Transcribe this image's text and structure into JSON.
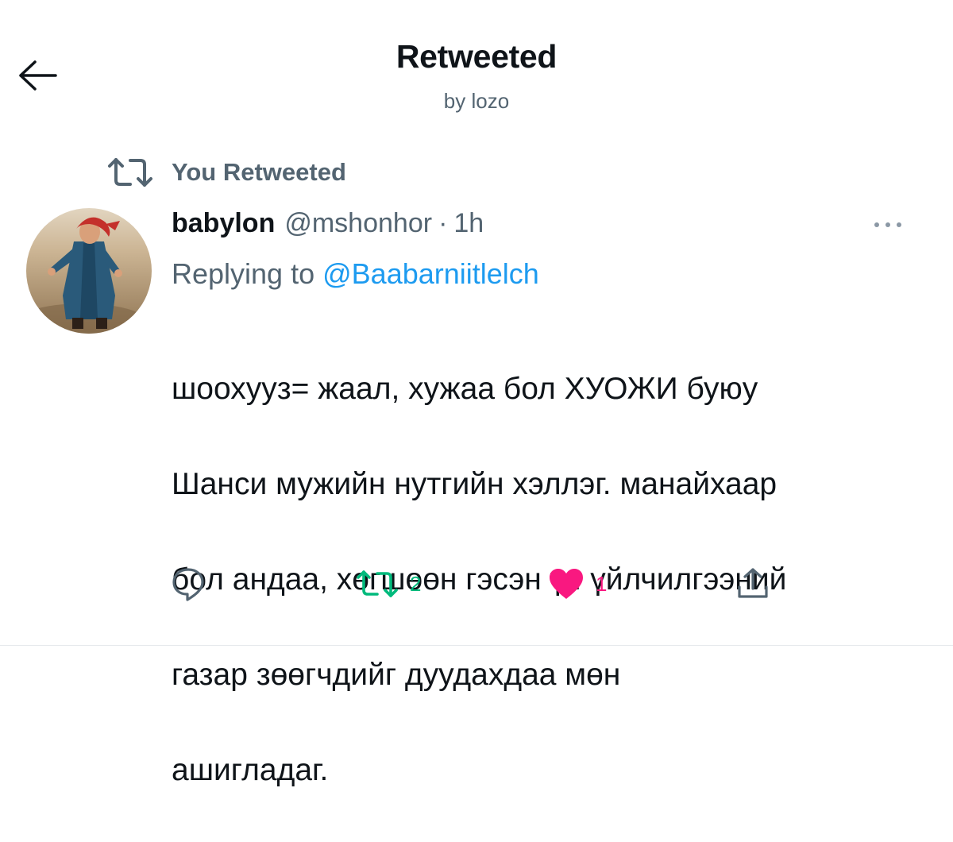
{
  "header": {
    "title": "Retweeted",
    "subtitle": "by lozo"
  },
  "social_context": {
    "label": "You Retweeted",
    "icon": "retweet-icon"
  },
  "tweet": {
    "display_name": "babylon",
    "handle": "@mshonhor",
    "separator": "·",
    "timestamp": "1h",
    "replying_prefix": "Replying to ",
    "replying_to": "@Baabarniitlelch",
    "text_lines": [
      "шоохууз= жаал, хужаа бол ХУОЖИ буюу",
      "Шанси мужийн нутгийн хэллэг. манайхаар",
      "бол андаа, хөгшөөн гэсэн үг. үйлчилгээний",
      "газар зөөгчдийг дуудахдаа мөн",
      "ашигладаг."
    ],
    "avatar": "avatar-photo-child-in-red-headscarf"
  },
  "actions": {
    "reply": {
      "icon": "reply-icon",
      "count": ""
    },
    "retweet": {
      "icon": "retweet-icon",
      "count": "2",
      "active": true
    },
    "like": {
      "icon": "heart-icon",
      "count": "1",
      "active": true
    },
    "share": {
      "icon": "share-icon"
    }
  },
  "colors": {
    "text_primary": "#0f1419",
    "text_secondary": "#536471",
    "link_blue": "#1d9bf0",
    "retweet_green": "#00ba7c",
    "like_pink": "#f91880"
  }
}
